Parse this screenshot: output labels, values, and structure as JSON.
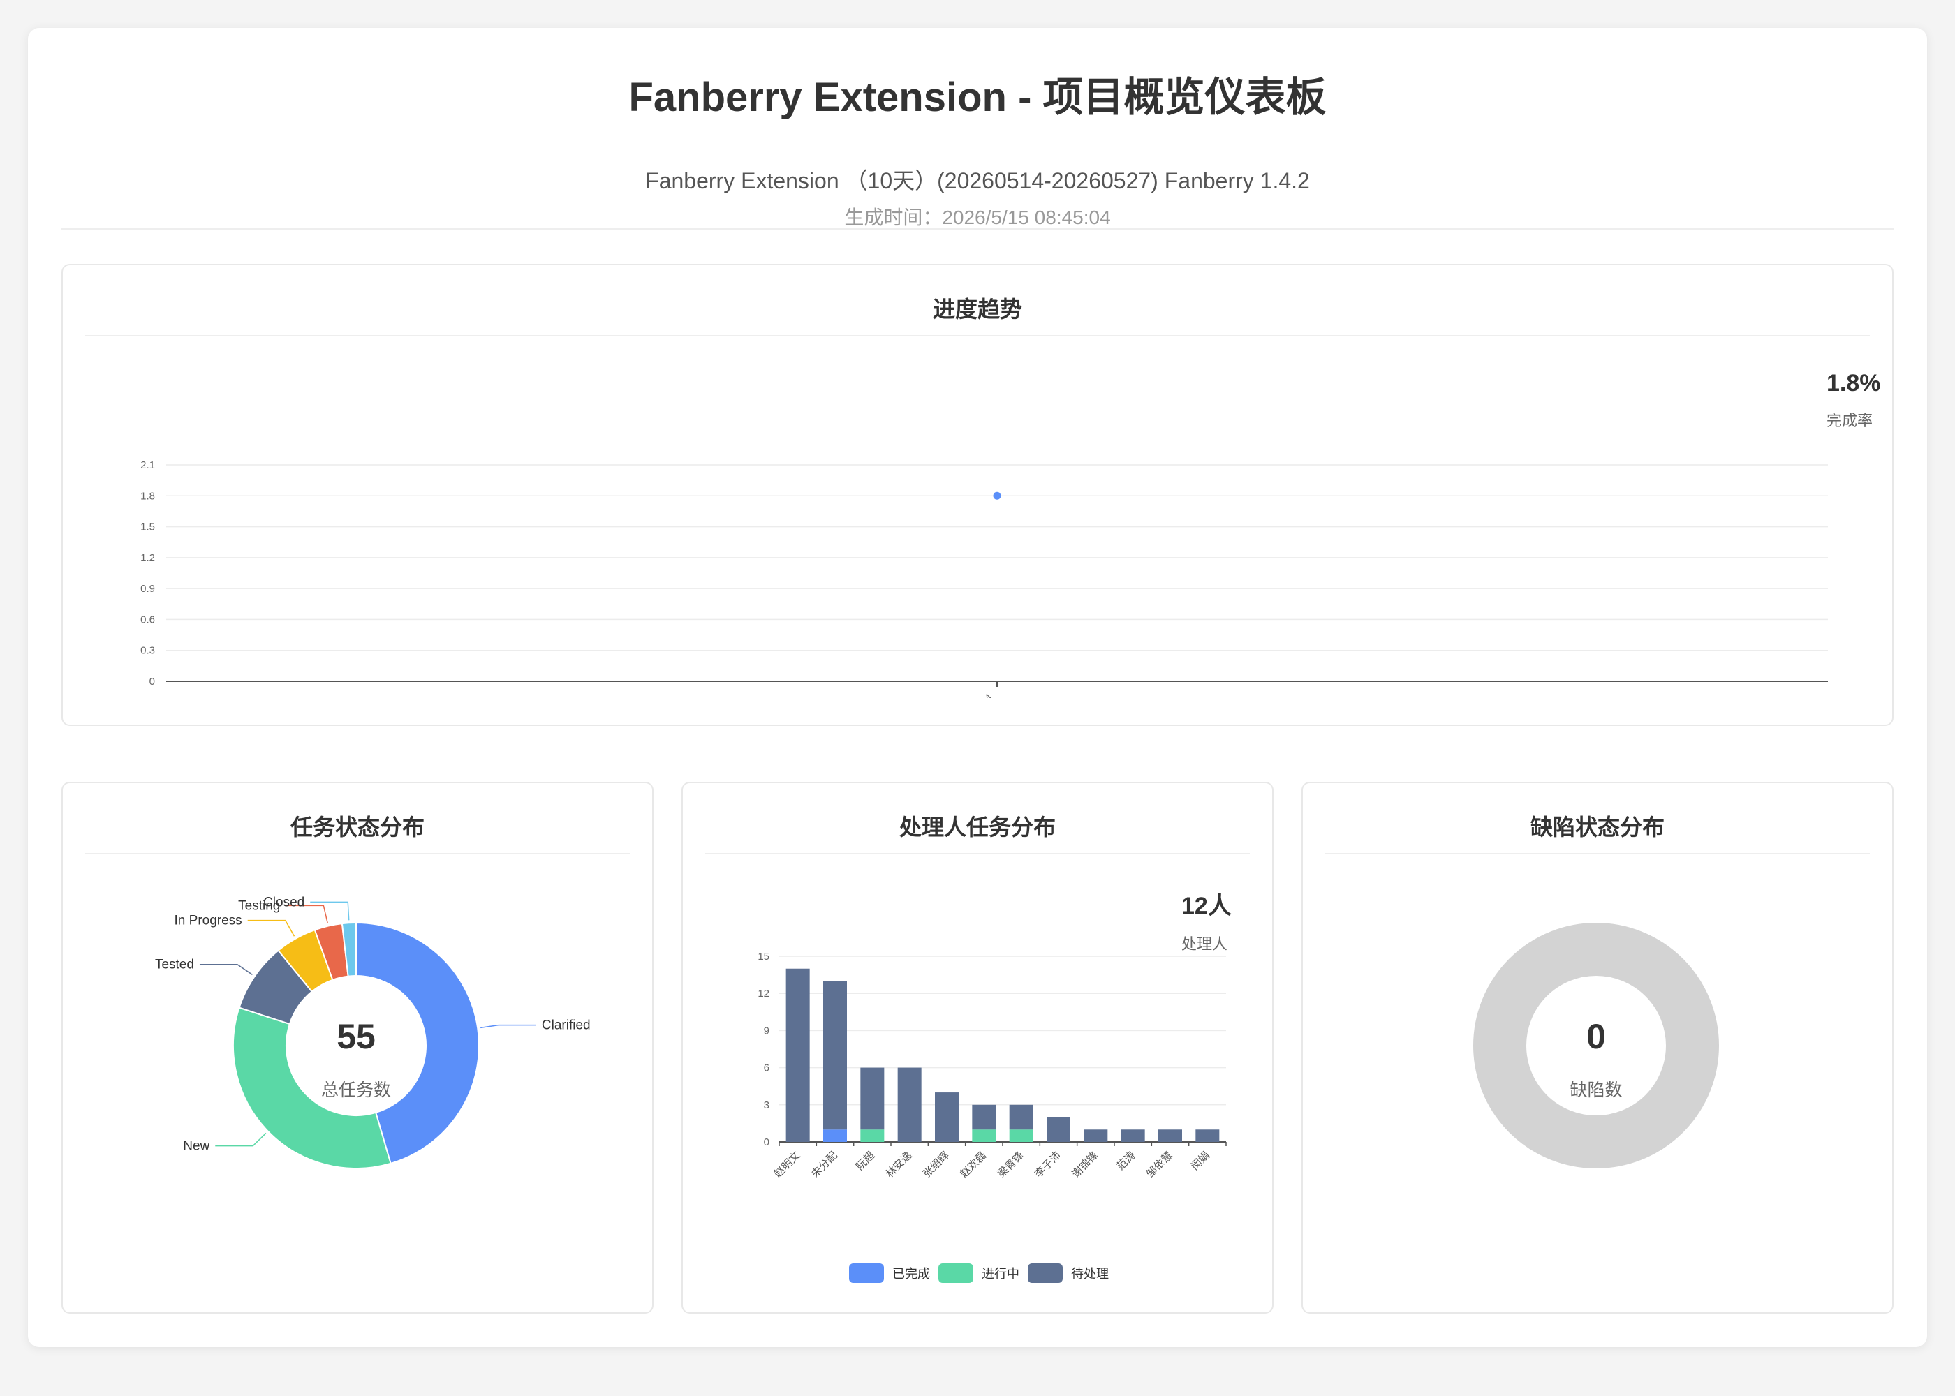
{
  "header": {
    "title": "Fanberry Extension - 项目概览仪表板",
    "subtitle": "Fanberry Extension （10天）(20260514-20260527) Fanberry 1.4.2",
    "generated": "生成时间：2026/5/15 08:45:04"
  },
  "trend": {
    "title": "进度趋势",
    "kpi_value": "1.8%",
    "kpi_label": "完成率"
  },
  "status": {
    "title": "任务状态分布",
    "center_value": "55",
    "center_label": "总任务数"
  },
  "assignee": {
    "title": "处理人任务分布",
    "kpi_value": "12人",
    "kpi_label": "处理人"
  },
  "defects": {
    "title": "缺陷状态分布",
    "center_value": "0",
    "center_label": "缺陷数"
  },
  "colors": {
    "blue": "#5b8ff9",
    "green": "#5ad8a6",
    "slate": "#5d7092",
    "yellow": "#f6bd16",
    "red": "#e8684a",
    "cyan": "#6dc8ec",
    "grey": "#d3d3d3"
  },
  "chart_data": [
    {
      "type": "line",
      "x": [
        "05/14"
      ],
      "series": [
        {
          "values": [
            1.8
          ]
        }
      ],
      "ylim": [
        0,
        2.1
      ],
      "yticks": [
        0,
        0.3,
        0.6,
        0.9,
        1.2,
        1.5,
        1.8,
        2.1
      ],
      "grid": true
    },
    {
      "type": "pie",
      "categories": [
        "Clarified",
        "New",
        "Tested",
        "In Progress",
        "Testing",
        "Closed"
      ],
      "values": [
        25,
        19,
        5,
        3,
        2,
        1
      ],
      "colors": [
        "#5b8ff9",
        "#5ad8a6",
        "#5d7092",
        "#f6bd16",
        "#e8684a",
        "#6dc8ec"
      ]
    },
    {
      "type": "bar",
      "stacked": true,
      "categories": [
        "赵明文",
        "未分配",
        "阮超",
        "林安逸",
        "张绍辉",
        "赵欢磊",
        "梁青锋",
        "李子沛",
        "谢锦锋",
        "范涛",
        "邹依慧",
        "闵娟"
      ],
      "series": [
        {
          "name": "已完成",
          "values": [
            0,
            1,
            0,
            0,
            0,
            0,
            0,
            0,
            0,
            0,
            0,
            0
          ],
          "color": "#5b8ff9"
        },
        {
          "name": "进行中",
          "values": [
            0,
            0,
            1,
            0,
            0,
            1,
            1,
            0,
            0,
            0,
            0,
            0
          ],
          "color": "#5ad8a6"
        },
        {
          "name": "待处理",
          "values": [
            14,
            12,
            5,
            6,
            4,
            2,
            2,
            2,
            1,
            1,
            1,
            1
          ],
          "color": "#5d7092"
        }
      ],
      "ylim": [
        0,
        15
      ],
      "yticks": [
        0,
        3,
        6,
        9,
        12,
        15
      ],
      "legend": "bottom"
    },
    {
      "type": "pie",
      "categories": [],
      "values": [],
      "total": 0
    }
  ]
}
